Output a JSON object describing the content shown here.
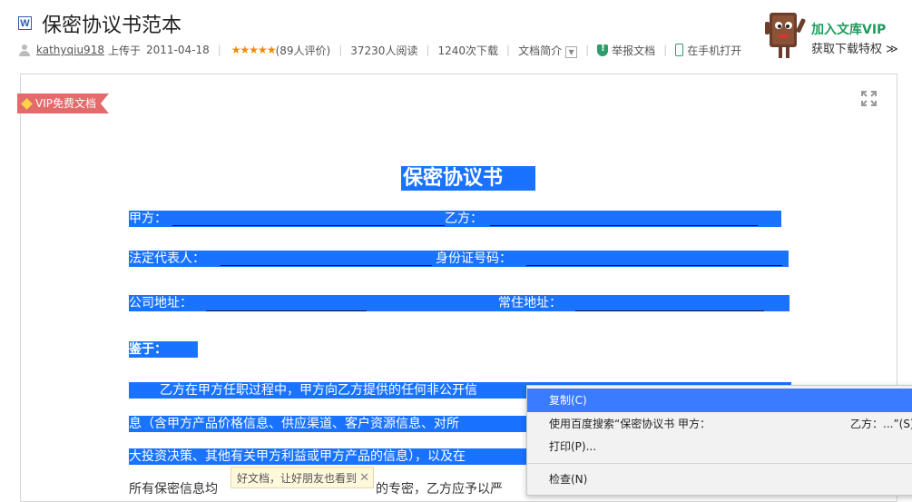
{
  "document": {
    "type_icon": "W",
    "title": "保密协议书范本"
  },
  "meta": {
    "author": "kathyqiu918",
    "uploaded_label": "上传于",
    "upload_date": "2011-04-18",
    "rating_stars": "★★★★★",
    "rating_count": "(89人评价)",
    "reads": "37230人阅读",
    "downloads": "1240次下载",
    "summary_label": "文档简介",
    "report_label": "举报文档",
    "mobile_label": "在手机打开"
  },
  "vip_promo": {
    "title": "加入文库VIP",
    "subtitle": "获取下载特权 ≫"
  },
  "badge": {
    "label": "VIP免费文档"
  },
  "content": {
    "heading": "保密协议书",
    "party_a_label": "甲方：",
    "party_b_label": "乙方：",
    "legal_rep_label": "法定代表人：",
    "id_label": "身份证号码：",
    "company_addr_label": "公司地址：",
    "residence_label": "常住地址：",
    "whereas_label": "鉴于：",
    "para_line1": "乙方在甲方任职过程中，甲方向乙方提供的任何非公开信",
    "para_line2": "息（含甲方产品价格信息、供应渠道、客户资源信息、对所",
    "para_line3": "大投资决策、其他有关甲方利益或甲方产品的信息），以及在",
    "para_line4_left": "所有保密信息均",
    "para_line4_right": "的专密，乙方应予以严"
  },
  "share_tip": {
    "text": "好文档，让好朋友也看到",
    "close": "✕"
  },
  "context_menu": {
    "items": [
      {
        "label": "复制(C)"
      },
      {
        "label": "使用百度搜索“保密协议书 甲方：",
        "extra": "乙方：...”(S)"
      },
      {
        "label": "打印(P)..."
      },
      {
        "label": "检查(N)"
      }
    ]
  },
  "icons": {
    "user": "user-icon",
    "shield": "shield-icon",
    "phone": "phone-icon",
    "fullscreen": "fullscreen-icon",
    "gem": "gem-icon"
  },
  "colors": {
    "selection": "#1a73ff",
    "vip_green": "#1f9b5c",
    "badge_red": "#e36b6b",
    "star_orange": "#f08a00"
  }
}
